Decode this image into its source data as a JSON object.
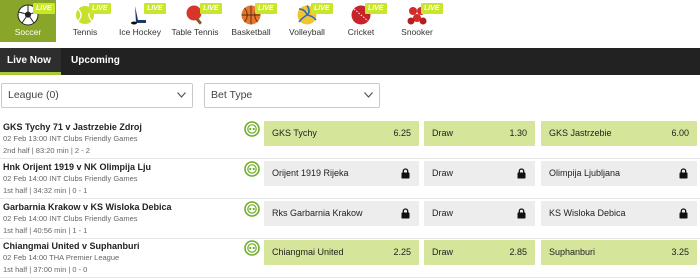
{
  "sports": [
    {
      "label": "Soccer",
      "live": "LIVE",
      "icon": "soccer-ball-icon",
      "active": true
    },
    {
      "label": "Tennis",
      "live": "LIVE",
      "icon": "tennis-ball-icon"
    },
    {
      "label": "Ice Hockey",
      "live": "LIVE",
      "icon": "hockey-stick-icon"
    },
    {
      "label": "Table Tennis",
      "live": "LIVE",
      "icon": "table-tennis-paddle-icon"
    },
    {
      "label": "Basketball",
      "live": "LIVE",
      "icon": "basketball-icon"
    },
    {
      "label": "Volleyball",
      "live": "LIVE",
      "icon": "volleyball-icon"
    },
    {
      "label": "Cricket",
      "live": "LIVE",
      "icon": "cricket-ball-icon"
    },
    {
      "label": "Snooker",
      "live": "LIVE",
      "icon": "snooker-balls-icon"
    }
  ],
  "tabs": [
    {
      "label": "Live Now",
      "active": true
    },
    {
      "label": "Upcoming"
    }
  ],
  "filters": {
    "league": "League (0)",
    "bet_type": "Bet Type"
  },
  "matches": [
    {
      "title": "GKS Tychy 71 v Jastrzebie Zdroj",
      "meta": "02 Feb 13:00 INT Clubs Friendly Games",
      "status": "2nd half | 83:20 min | 2 - 2",
      "odds": [
        {
          "selection": "GKS Tychy",
          "price": "6.25",
          "locked": false
        },
        {
          "selection": "Draw",
          "price": "1.30",
          "locked": false
        },
        {
          "selection": "GKS Jastrzebie",
          "price": "6.00",
          "locked": false
        }
      ]
    },
    {
      "title": "Hnk Orijent 1919 v NK Olimpija Lju",
      "meta": "02 Feb 14:00 INT Clubs Friendly Games",
      "status": "1st half | 34:32 min | 0 - 1",
      "odds": [
        {
          "selection": "Orijent 1919 Rijeka",
          "price": "",
          "locked": true
        },
        {
          "selection": "Draw",
          "price": "",
          "locked": true
        },
        {
          "selection": "Olimpija Ljubljana",
          "price": "",
          "locked": true
        }
      ]
    },
    {
      "title": "Garbarnia Krakow v KS Wisloka Debica",
      "meta": "02 Feb 14:00 INT Clubs Friendly Games",
      "status": "1st half | 40:56 min | 1 - 1",
      "odds": [
        {
          "selection": "Rks Garbarnia Krakow",
          "price": "",
          "locked": true
        },
        {
          "selection": "Draw",
          "price": "",
          "locked": true
        },
        {
          "selection": "KS Wisloka Debica",
          "price": "",
          "locked": true
        }
      ]
    },
    {
      "title": "Chiangmai United v Suphanburi",
      "meta": "02 Feb 14:00 THA Premier League",
      "status": "1st half | 37:00 min | 0 - 0",
      "odds": [
        {
          "selection": "Chiangmai United",
          "price": "2.25",
          "locked": false
        },
        {
          "selection": "Draw",
          "price": "2.85",
          "locked": false
        },
        {
          "selection": "Suphanburi",
          "price": "3.25",
          "locked": false
        }
      ]
    }
  ],
  "colors": {
    "accent": "#8aa62a",
    "live_badge": "#c8e62c",
    "odds_live": "#d5e59a",
    "odds_locked": "#ededed",
    "tab_bar": "#222222"
  }
}
